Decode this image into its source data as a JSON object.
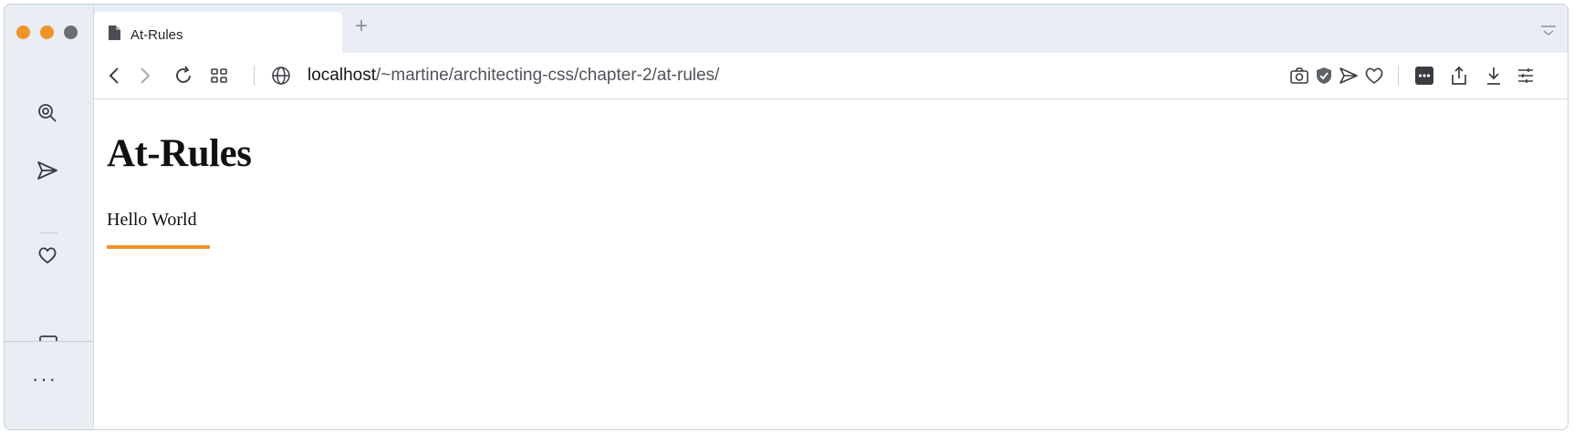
{
  "window": {
    "traffic_lights": {
      "close_color": "#f0932b",
      "minimize_color": "#f0932b",
      "zoom_color": "#6b6e73"
    }
  },
  "sidebar": {
    "items": [
      {
        "name": "search-icon"
      },
      {
        "name": "send-icon"
      },
      {
        "name": "heart-icon"
      },
      {
        "name": "notes-icon"
      }
    ],
    "more_label": "···"
  },
  "tabs": [
    {
      "title": "At-Rules",
      "icon": "document-icon",
      "active": true
    }
  ],
  "new_tab_label": "+",
  "toolbar": {
    "url_host": "localhost",
    "url_path": "/~martine/architecting-css/chapter-2/at-rules/",
    "left_icons": [
      "back-icon",
      "forward-icon",
      "reload-icon",
      "tab-grid-icon",
      "globe-icon"
    ],
    "right_icons": [
      "camera-icon",
      "shield-icon",
      "send-icon",
      "heart-icon",
      "extension-icon",
      "share-icon",
      "download-icon",
      "settings-icon"
    ]
  },
  "page": {
    "heading": "At-Rules",
    "paragraph": "Hello World",
    "accent_color": "#f0932b"
  }
}
